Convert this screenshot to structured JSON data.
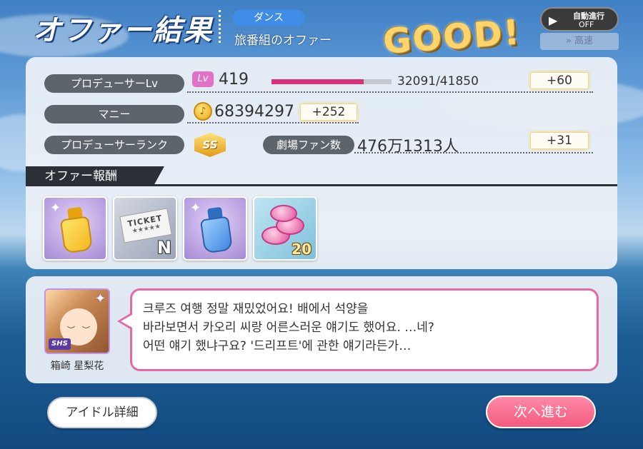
{
  "header": {
    "title": "オファー結果",
    "tag": "ダンス",
    "offer_name": "旅番組のオファー",
    "result": "GOOD!"
  },
  "controls": {
    "auto_label": "自動進行",
    "auto_state": "OFF",
    "speed_label": "高速"
  },
  "stats": {
    "producer_lv": {
      "label": "プロデューサーLv",
      "badge": "Lv",
      "value": "419",
      "xp_text": "32091/41850",
      "xp_fraction": 0.7668,
      "gain": "+60"
    },
    "money": {
      "label": "マニー",
      "value": "68394297",
      "gain": "+252"
    },
    "rank": {
      "label": "プロデューサーランク",
      "badge": "SS"
    },
    "fans": {
      "label": "劇場ファン数",
      "value": "476万1313人",
      "gain": "+31"
    }
  },
  "rewards": {
    "header": "オファー報酬",
    "items": [
      {
        "icon": "yellow-bottle-icon",
        "color": "#f3b61f"
      },
      {
        "icon": "ticket-icon",
        "ticket_text": "TICKET",
        "rarity": "N"
      },
      {
        "icon": "blue-bottle-icon",
        "color": "#3f86e0"
      },
      {
        "icon": "pink-coins-icon",
        "count": "20"
      }
    ]
  },
  "message": {
    "character_name": "箱崎 星梨花",
    "card_rarity": "SHS",
    "lines": [
      "크루즈 여행 정말 재밌었어요! 배에서 석양을",
      "바라보면서 카오리 씨랑 어른스러운 얘기도 했어요. …네?",
      "어떤 얘기 했냐구요? '드리프트'에 관한 얘기라든가…"
    ]
  },
  "buttons": {
    "idol_detail": "アイドル詳細",
    "next": "次へ進む"
  },
  "colors": {
    "accent_pink": "#e36aa4",
    "bar_fill": "#d8327d",
    "label_pill": "#5e646c"
  }
}
